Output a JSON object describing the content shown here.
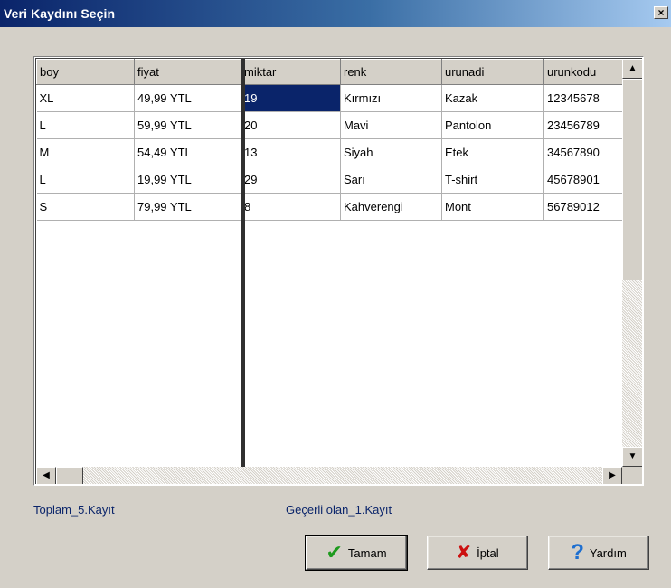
{
  "window": {
    "title": "Veri Kaydını Seçin",
    "close_glyph": "×"
  },
  "grid": {
    "columns": [
      "boy",
      "fiyat",
      "miktar",
      "renk",
      "urunadi",
      "urunkodu"
    ],
    "rows": [
      [
        "XL",
        "49,99 YTL",
        "19",
        "Kırmızı",
        "Kazak",
        "12345678"
      ],
      [
        "L",
        "59,99 YTL",
        "20",
        "Mavi",
        "Pantolon",
        "23456789"
      ],
      [
        "M",
        "54,49 YTL",
        "13",
        "Siyah",
        "Etek",
        "34567890"
      ],
      [
        "L",
        "19,99 YTL",
        "29",
        "Sarı",
        "T-shirt",
        "45678901"
      ],
      [
        "S",
        "79,99 YTL",
        "8",
        "Kahverengi",
        "Mont",
        "56789012"
      ]
    ],
    "selected_cell": {
      "row": 0,
      "col": 2
    },
    "selected_color": "#0a246a",
    "scroll_up_glyph": "▲",
    "scroll_down_glyph": "▼",
    "scroll_left_glyph": "◀",
    "scroll_right_glyph": "▶"
  },
  "status": {
    "total": "Toplam_5.Kayıt",
    "current": "Geçerli olan_1.Kayıt"
  },
  "buttons": {
    "ok": {
      "label": "Tamam",
      "icon": "check-icon",
      "glyph": "✔"
    },
    "cancel": {
      "label": "İptal",
      "icon": "x-icon",
      "glyph": "✘"
    },
    "help": {
      "label": "Yardım",
      "icon": "question-icon",
      "glyph": "?"
    }
  },
  "colors": {
    "title_start": "#0a246a",
    "title_end": "#a6caf0",
    "status_text": "#0a246a"
  }
}
